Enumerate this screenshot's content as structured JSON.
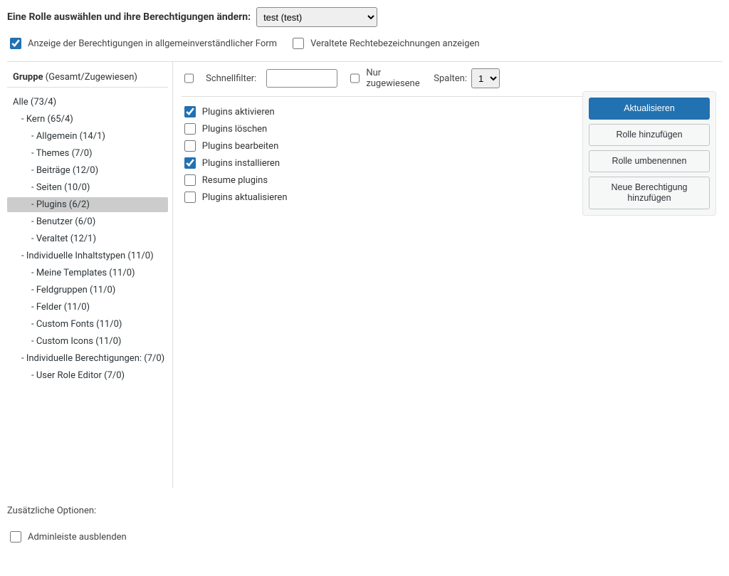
{
  "header": {
    "title": "Eine Rolle auswählen und ihre Berechtigungen ändern:",
    "role_select": "test (test)"
  },
  "top_checks": {
    "readable_checked": true,
    "readable_label": "Anzeige der Berechtigungen in allgemeinverständlicher Form",
    "deprecated_checked": false,
    "deprecated_label": "Veraltete Rechtebezeichnungen anzeigen"
  },
  "sidebar": {
    "header_bold": "Gruppe",
    "header_rest": " (Gesamt/Zugewiesen)",
    "items": [
      {
        "label": "Alle (73/4)",
        "lvl": 0
      },
      {
        "label": "- Kern (65/4)",
        "lvl": 1
      },
      {
        "label": "- Allgemein (14/1)",
        "lvl": 2
      },
      {
        "label": "- Themes (7/0)",
        "lvl": 2
      },
      {
        "label": "- Beiträge (12/0)",
        "lvl": 2
      },
      {
        "label": "- Seiten (10/0)",
        "lvl": 2
      },
      {
        "label": "- Plugins (6/2)",
        "lvl": 2,
        "active": true
      },
      {
        "label": "- Benutzer (6/0)",
        "lvl": 2
      },
      {
        "label": "- Veraltet (12/1)",
        "lvl": 2
      },
      {
        "label": "- Individuelle Inhaltstypen (11/0)",
        "lvl": 1
      },
      {
        "label": "- Meine Templates (11/0)",
        "lvl": 2
      },
      {
        "label": "- Feldgruppen (11/0)",
        "lvl": 2
      },
      {
        "label": "- Felder (11/0)",
        "lvl": 2
      },
      {
        "label": "- Custom Fonts (11/0)",
        "lvl": 2
      },
      {
        "label": "- Custom Icons (11/0)",
        "lvl": 2
      },
      {
        "label": "- Individuelle Berechtigungen: (7/0)",
        "lvl": 1
      },
      {
        "label": "- User Role Editor (7/0)",
        "lvl": 2
      }
    ]
  },
  "filter": {
    "selectall_checked": false,
    "quick_label": "Schnellfilter:",
    "quick_value": "",
    "only_assigned_checked": false,
    "only_assigned_label": "Nur zugewiesene",
    "columns_label": "Spalten:",
    "columns_value": "1"
  },
  "caps": [
    {
      "label": "Plugins aktivieren",
      "checked": true
    },
    {
      "label": "Plugins löschen",
      "checked": false
    },
    {
      "label": "Plugins bearbeiten",
      "checked": false
    },
    {
      "label": "Plugins installieren",
      "checked": true
    },
    {
      "label": "Resume plugins",
      "checked": false
    },
    {
      "label": "Plugins aktualisieren",
      "checked": false
    }
  ],
  "actions": {
    "update": "Aktualisieren",
    "add_role": "Rolle hinzufügen",
    "rename_role": "Rolle umbenennen",
    "add_cap": "Neue Berechtigung hinzufügen"
  },
  "footer": {
    "heading": "Zusätzliche Optionen:",
    "hide_adminbar_checked": false,
    "hide_adminbar_label": "Adminleiste ausblenden"
  }
}
